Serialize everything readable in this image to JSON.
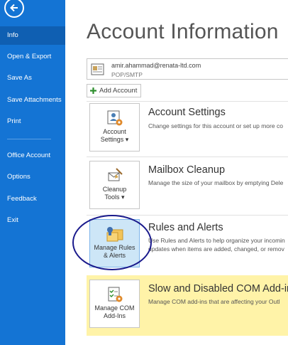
{
  "sidebar": {
    "items": [
      {
        "label": "Info"
      },
      {
        "label": "Open & Export"
      },
      {
        "label": "Save As"
      },
      {
        "label": "Save Attachments"
      },
      {
        "label": "Print"
      },
      {
        "label": "Office Account"
      },
      {
        "label": "Options"
      },
      {
        "label": "Feedback"
      },
      {
        "label": "Exit"
      }
    ]
  },
  "main": {
    "title": "Account Information",
    "account": {
      "email": "amir.ahammad@renata-ltd.com",
      "type": "POP/SMTP"
    },
    "add_account_label": "Add Account",
    "sections": [
      {
        "tile_line1": "Account",
        "tile_line2": "Settings ▾",
        "title": "Account Settings",
        "description": "Change settings for this account or set up more co"
      },
      {
        "tile_line1": "Cleanup",
        "tile_line2": "Tools ▾",
        "title": "Mailbox Cleanup",
        "description": "Manage the size of your mailbox by emptying Dele"
      },
      {
        "tile_line1": "Manage Rules",
        "tile_line2": "& Alerts",
        "title": "Rules and Alerts",
        "description": "Use Rules and Alerts to help organize your incomin",
        "description2": "updates when items are added, changed, or remov"
      },
      {
        "tile_line1": "Manage COM",
        "tile_line2": "Add-Ins",
        "title": "Slow and Disabled COM Add-ins",
        "description": "Manage COM add-ins that are affecting your Outl"
      }
    ]
  },
  "colors": {
    "sidebar": "#1474d4",
    "sidebar_active": "#0f5fb2",
    "highlight": "#fff3a8",
    "annotation": "#1a1a8c"
  }
}
